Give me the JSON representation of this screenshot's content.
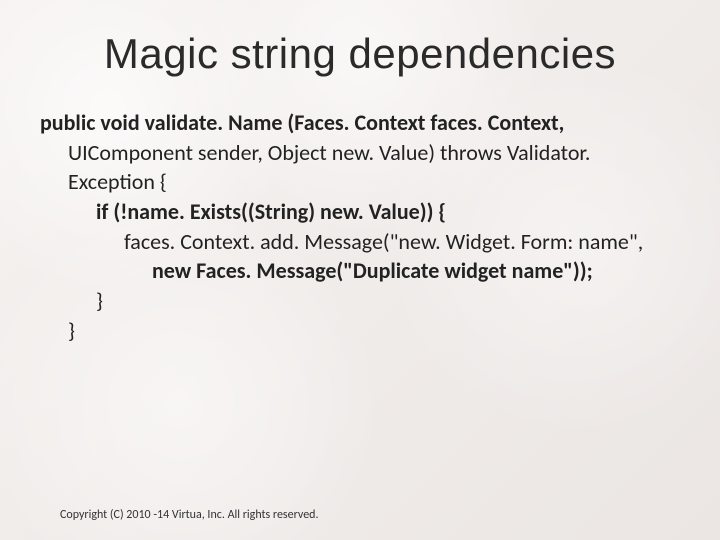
{
  "title": "Magic string dependencies",
  "code": {
    "l1": "public void validate. Name (Faces. Context faces. Context,",
    "l2": "UIComponent sender, Object new. Value) throws Validator. Exception {",
    "l3": "if (!name. Exists((String) new. Value)) {",
    "l4": "faces. Context. add. Message(\"new. Widget. Form: name\",",
    "l5": "new Faces. Message(\"Duplicate widget name\"));",
    "l6": "}",
    "l7": "}"
  },
  "copyright": "Copyright (C) 2010 -14 Virtua, Inc. All rights reserved."
}
